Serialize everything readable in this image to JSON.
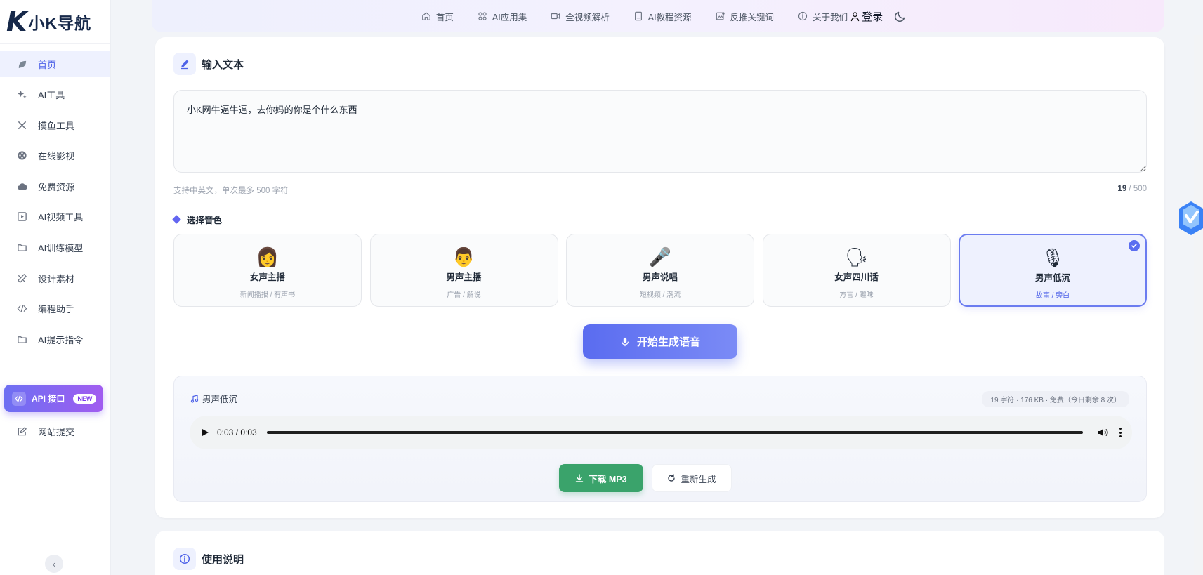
{
  "brand": {
    "logo_mark": "K",
    "name": "小K导航"
  },
  "sidebar": {
    "items": [
      {
        "label": "首页",
        "icon": "leaf-icon",
        "active": true
      },
      {
        "label": "AI工具",
        "icon": "sparkle-icon"
      },
      {
        "label": "摸鱼工具",
        "icon": "tools-icon"
      },
      {
        "label": "在线影视",
        "icon": "film-reel-icon"
      },
      {
        "label": "免费资源",
        "icon": "cloud-icon"
      },
      {
        "label": "AI视频工具",
        "icon": "play-square-icon"
      },
      {
        "label": "AI训练模型",
        "icon": "folder-icon"
      },
      {
        "label": "设计素材",
        "icon": "design-tools-icon"
      },
      {
        "label": "编程助手",
        "icon": "code-icon"
      },
      {
        "label": "AI提示指令",
        "icon": "folder-icon"
      }
    ],
    "api": {
      "label": "API 接口",
      "badge": "NEW"
    },
    "submit": {
      "label": "网站提交"
    }
  },
  "topnav": {
    "items": [
      {
        "label": "首页",
        "icon": "home-icon"
      },
      {
        "label": "AI应用集",
        "icon": "apps-icon"
      },
      {
        "label": "全视频解析",
        "icon": "video-icon"
      },
      {
        "label": "AI教程资源",
        "icon": "book-icon"
      },
      {
        "label": "反推关键词",
        "icon": "image-search-icon"
      },
      {
        "label": "关于我们",
        "icon": "info-icon"
      }
    ],
    "login": "登录"
  },
  "input_section": {
    "title": "输入文本",
    "text": "小K网牛逼牛逼，去你妈的你是个什么东西",
    "hint": "支持中英文，单次最多 500 字符",
    "count": "19",
    "max": "500"
  },
  "voice_section": {
    "title": "选择音色",
    "voices": [
      {
        "emoji": "👩",
        "name": "女声主播",
        "desc": "新闻播报 / 有声书"
      },
      {
        "emoji": "👨",
        "name": "男声主播",
        "desc": "广告 / 解说"
      },
      {
        "emoji": "🎤",
        "name": "男声说唱",
        "desc": "短视频 / 潮流"
      },
      {
        "emoji": "🗣",
        "name": "女声四川话",
        "desc": "方言 / 趣味"
      },
      {
        "emoji": "🎙",
        "name": "男声低沉",
        "desc": "故事 / 旁白",
        "selected": true
      }
    ]
  },
  "generate_button": "开始生成语音",
  "result": {
    "voice_name": "男声低沉",
    "meta": "19 字符 · 176 KB · 免费（今日剩余 8 次）",
    "time": "0:03 / 0:03",
    "progress": 1.0,
    "download_label": "下载 MP3",
    "regenerate_label": "重新生成"
  },
  "instructions": {
    "title": "使用说明"
  },
  "colors": {
    "accent": "#5a6cf0",
    "download": "#3aa36b",
    "api_gradient_start": "#6d6ff2",
    "api_gradient_end": "#a15cf0"
  }
}
